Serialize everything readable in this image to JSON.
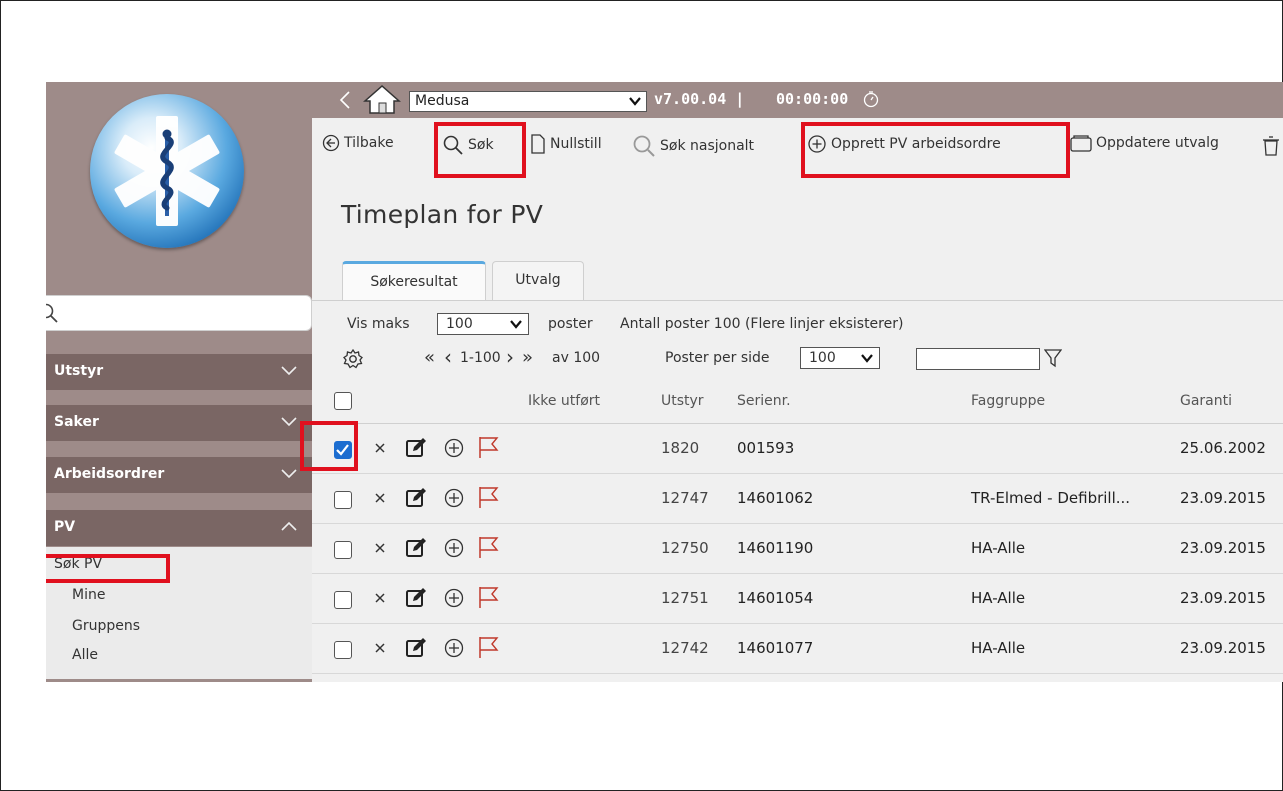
{
  "sidebar": {
    "search": {
      "placeholder": ""
    },
    "sections": [
      {
        "label": "Utstyr",
        "expanded": false
      },
      {
        "label": "Saker",
        "expanded": false
      },
      {
        "label": "Arbeidsordrer",
        "expanded": false
      },
      {
        "label": "PV",
        "expanded": true
      }
    ],
    "pv_items": [
      "Søk PV",
      "Mine",
      "Gruppens",
      "Alle"
    ]
  },
  "topbar": {
    "system": "Medusa",
    "version": "v7.00.04",
    "separator": "|",
    "timer": "00:00:00"
  },
  "toolbar": {
    "back": "Tilbake",
    "search": "Søk",
    "reset": "Nullstill",
    "national_search": "Søk nasjonalt",
    "create_pv": "Opprett PV arbeidsordre",
    "update_selection": "Oppdatere utvalg"
  },
  "page": {
    "title": "Timeplan for PV"
  },
  "tabs": [
    {
      "label": "Søkeresultat",
      "active": true
    },
    {
      "label": "Utvalg",
      "active": false
    }
  ],
  "results": {
    "vis_maks_label": "Vis maks",
    "vis_maks_value": "100",
    "poster_label": "poster",
    "count_text": "Antall poster 100 (Flere linjer eksisterer)"
  },
  "pager": {
    "first": "«",
    "prev": "‹",
    "range": "1-100",
    "next": "›",
    "last": "»",
    "of_text": "av 100",
    "per_page_label": "Poster per side",
    "per_page_value": "100",
    "filter_value": ""
  },
  "table": {
    "columns": [
      "Ikke utført",
      "Utstyr",
      "Serienr.",
      "Faggruppe",
      "Garanti"
    ],
    "rows": [
      {
        "checked": true,
        "utstyr": "1820",
        "serienr": "001593",
        "faggruppe": "",
        "garanti": "25.06.2002"
      },
      {
        "checked": false,
        "utstyr": "12747",
        "serienr": "14601062",
        "faggruppe": "TR-Elmed - Defibrill...",
        "garanti": "23.09.2015"
      },
      {
        "checked": false,
        "utstyr": "12750",
        "serienr": "14601190",
        "faggruppe": "HA-Alle",
        "garanti": "23.09.2015"
      },
      {
        "checked": false,
        "utstyr": "12751",
        "serienr": "14601054",
        "faggruppe": "HA-Alle",
        "garanti": "23.09.2015"
      },
      {
        "checked": false,
        "utstyr": "12742",
        "serienr": "14601077",
        "faggruppe": "HA-Alle",
        "garanti": "23.09.2015"
      }
    ]
  },
  "colors": {
    "sidebar_bg": "#9e8b89",
    "section_bg": "#7a6664",
    "highlight": "#e0101e",
    "checkbox": "#1c6dd0",
    "flag": "#c0392b"
  }
}
